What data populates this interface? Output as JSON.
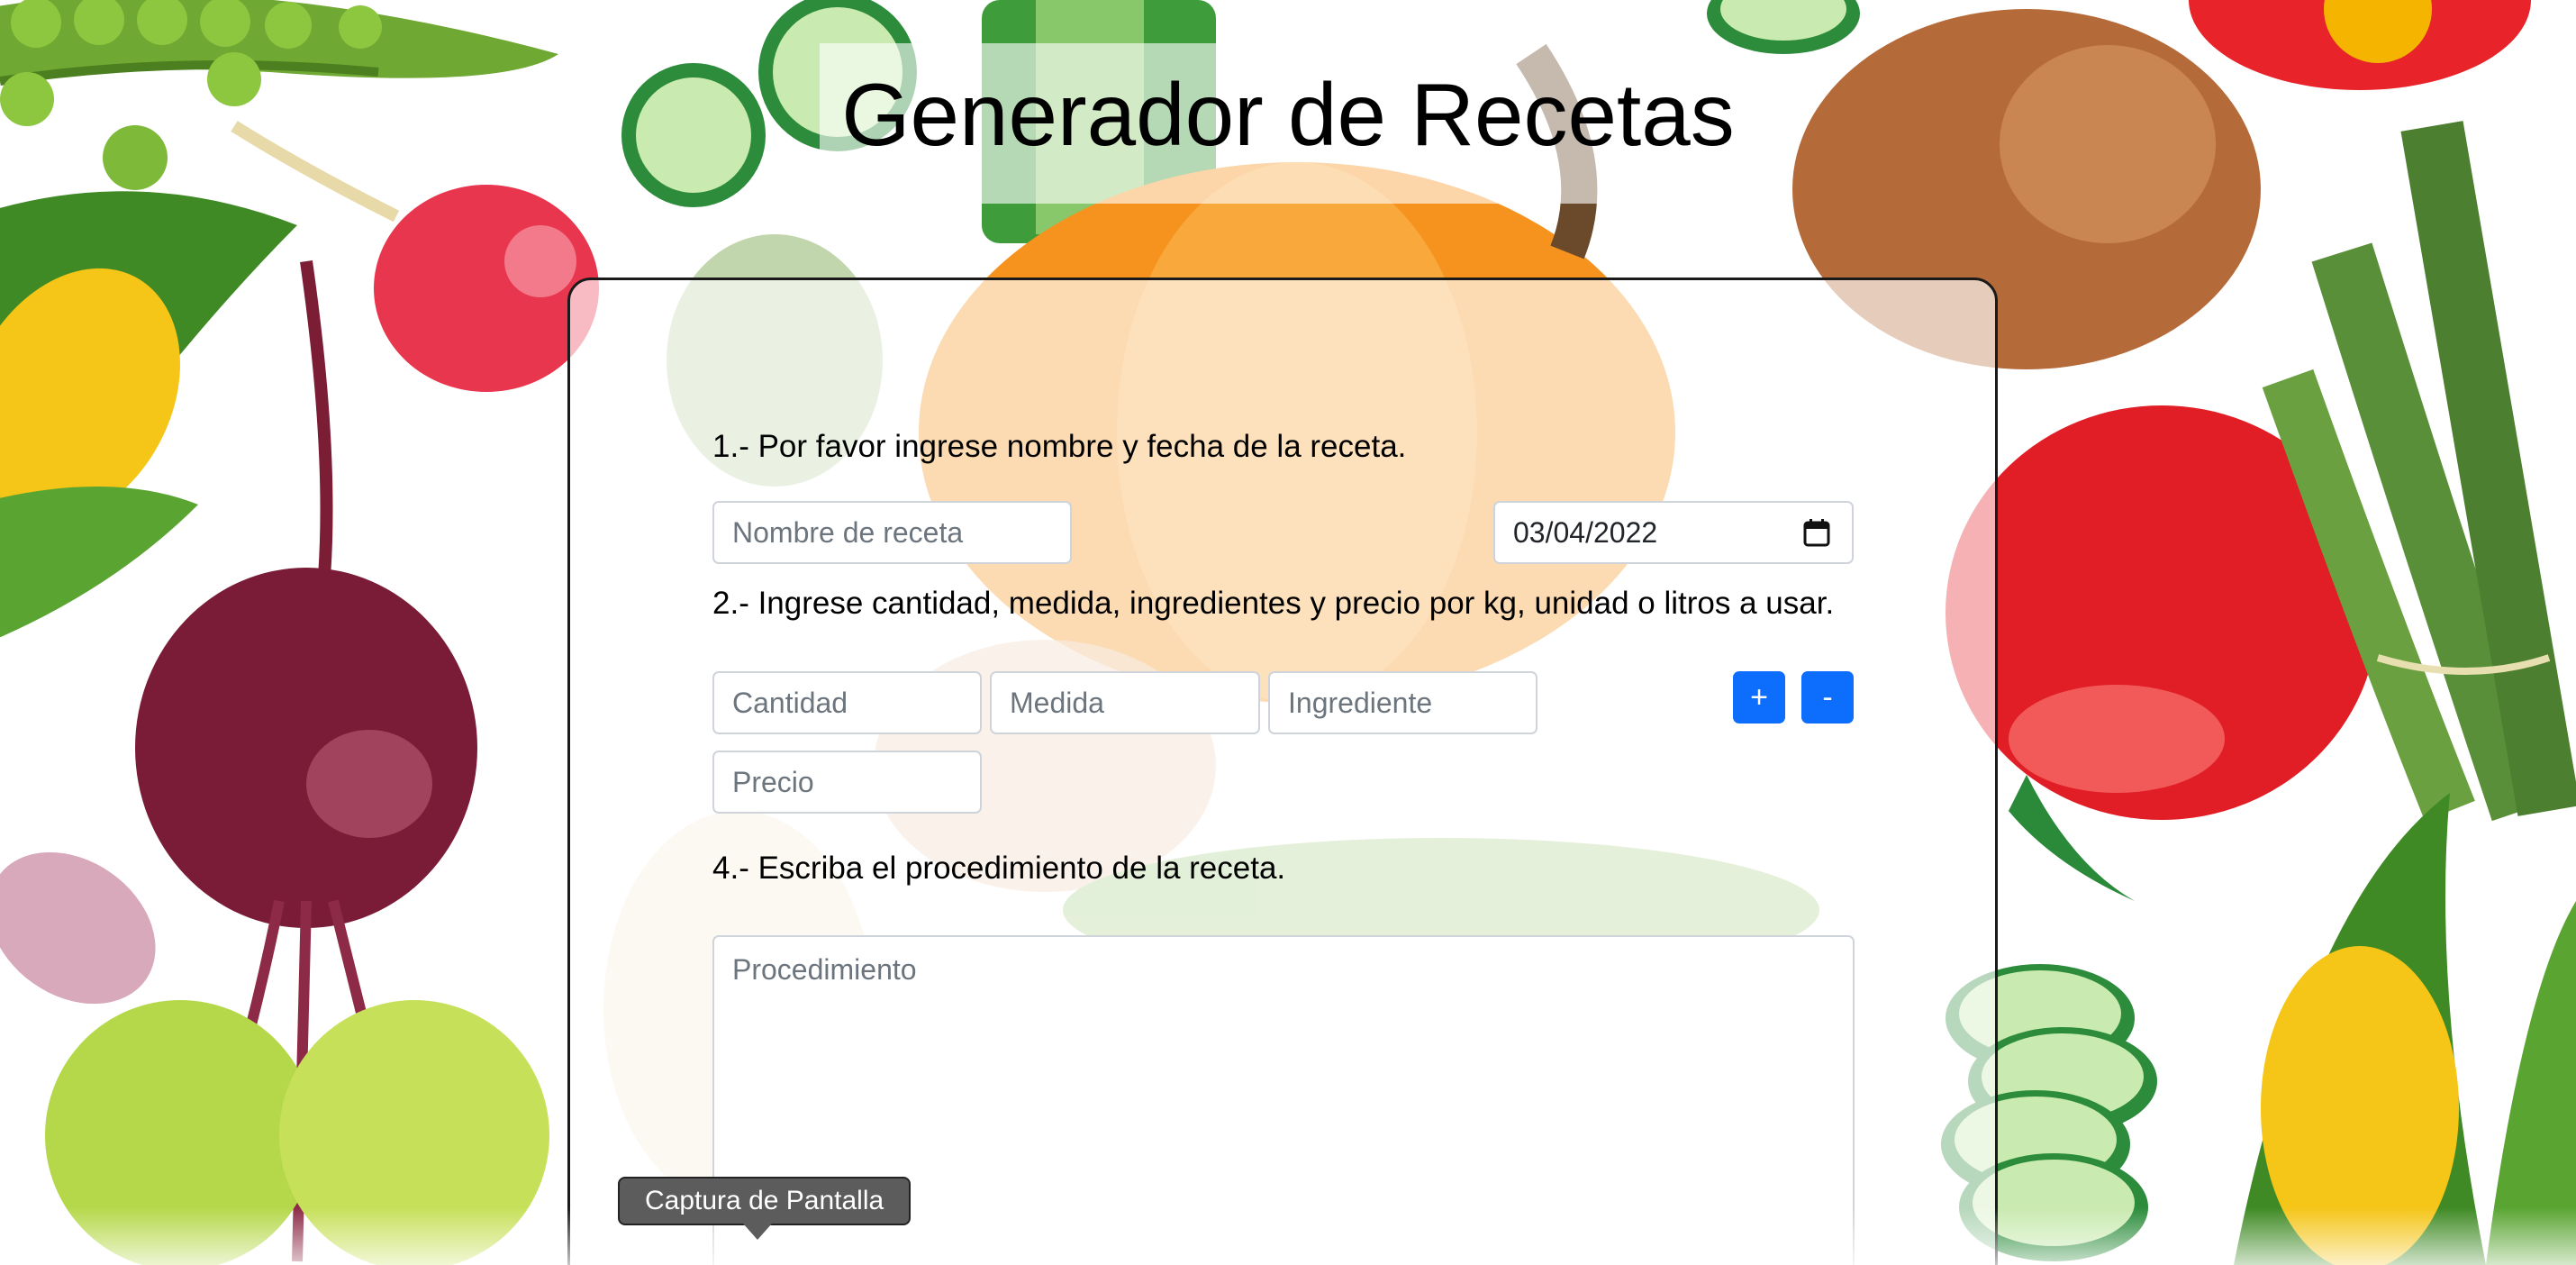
{
  "page": {
    "title": "Generador de Recetas"
  },
  "form": {
    "step1_label": "1.- Por favor ingrese nombre y fecha de la receta.",
    "recipe_name_placeholder": "Nombre de receta",
    "recipe_name_value": "",
    "date_value": "03/04/2022",
    "step2_label": "2.- Ingrese cantidad, medida, ingredientes y precio por kg, unidad o litros a usar.",
    "quantity_placeholder": "Cantidad",
    "measure_placeholder": "Medida",
    "ingredient_placeholder": "Ingrediente",
    "price_placeholder": "Precio",
    "add_label": "+",
    "remove_label": "-",
    "step4_label": "4.- Escriba el procedimiento de la receta.",
    "procedure_placeholder": "Procedimiento"
  },
  "tooltip": {
    "text": "Captura de Pantalla"
  },
  "colors": {
    "primary_button": "#0d6efd",
    "card_border": "#1a1a1a",
    "tooltip_bg": "#5c5c5c"
  },
  "icons": {
    "date_picker": "calendar-icon"
  }
}
